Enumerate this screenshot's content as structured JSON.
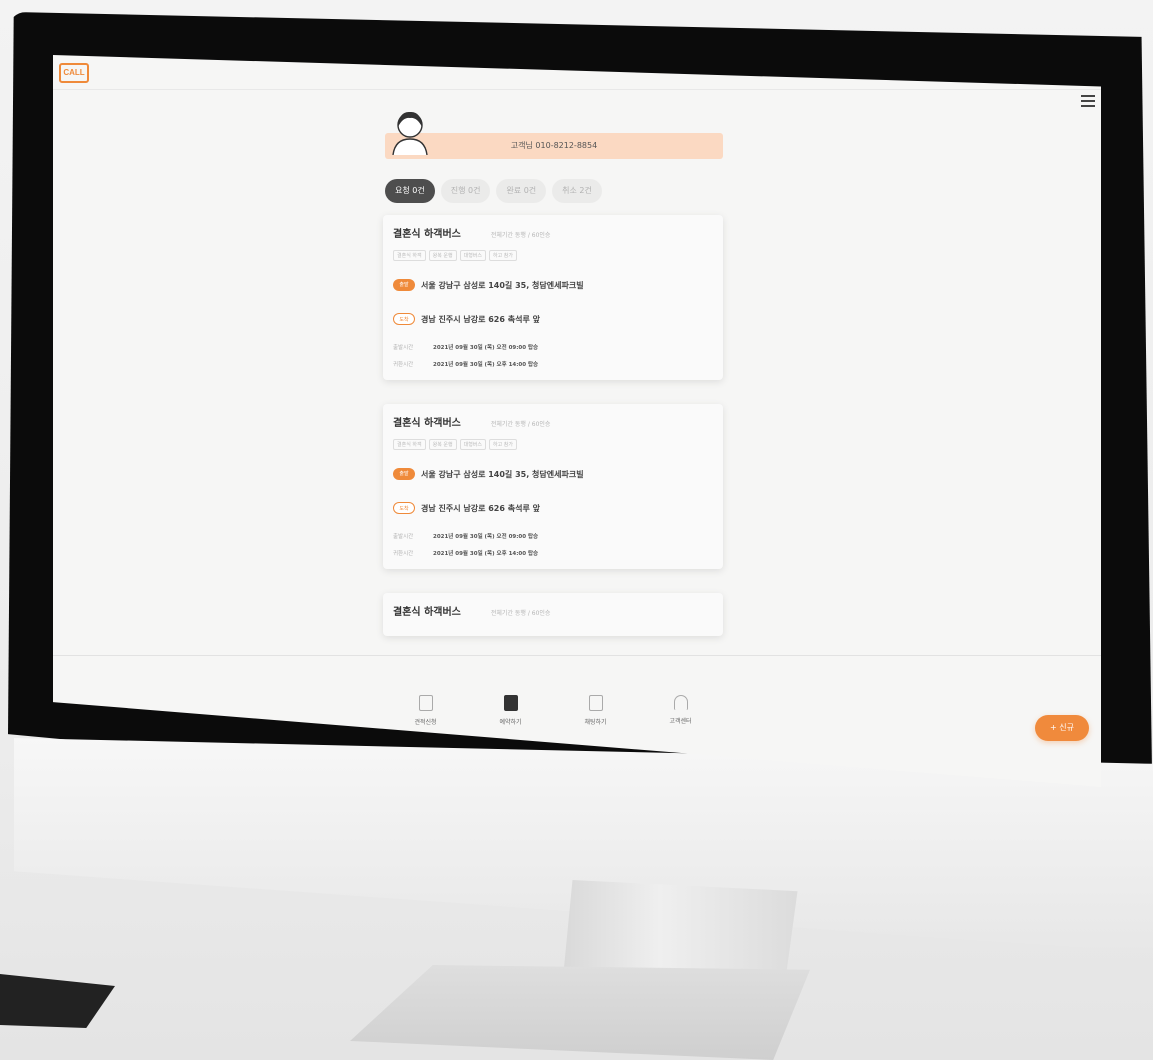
{
  "app": {
    "logo_text": "CALL"
  },
  "profile": {
    "phone_label": "고객님 010-8212-8854"
  },
  "tabs": [
    {
      "label": "요청 0건",
      "active": true
    },
    {
      "label": "진행 0건",
      "active": false
    },
    {
      "label": "완료 0건",
      "active": false
    },
    {
      "label": "취소 2건",
      "active": false
    }
  ],
  "cards": [
    {
      "title": "결혼식 하객버스",
      "subtitle": "전체기간 동행 / 60인승",
      "tags": [
        "결혼식 하객",
        "왕복 운행",
        "대형버스",
        "하고 참가"
      ],
      "depart_badge": "출발",
      "depart": "서울 강남구 삼성로 140길 35, 청담엔세파크빌",
      "arrive_badge": "도착",
      "arrive": "경남 진주시 남강로 626 촉석루 앞",
      "times": [
        {
          "label": "출발시간",
          "value": "2021년 09월 30일 (목) 오전 09:00 탑승"
        },
        {
          "label": "귀환시간",
          "value": "2021년 09월 30일 (목) 오후 14:00 탑승"
        }
      ]
    },
    {
      "title": "결혼식 하객버스",
      "subtitle": "전체기간 동행 / 60인승",
      "tags": [
        "결혼식 하객",
        "왕복 운행",
        "대형버스",
        "하고 참가"
      ],
      "depart_badge": "출발",
      "depart": "서울 강남구 삼성로 140길 35, 청담엔세파크빌",
      "arrive_badge": "도착",
      "arrive": "경남 진주시 남강로 626 촉석루 앞",
      "times": [
        {
          "label": "출발시간",
          "value": "2021년 09월 30일 (목) 오전 09:00 탑승"
        },
        {
          "label": "귀환시간",
          "value": "2021년 09월 30일 (목) 오후 14:00 탑승"
        }
      ]
    },
    {
      "title": "결혼식 하객버스",
      "subtitle": "전체기간 동행 / 60인승"
    }
  ],
  "bottom_nav": [
    {
      "label": "견적신청",
      "icon": "document-icon",
      "active": false
    },
    {
      "label": "예약하기",
      "icon": "book-icon",
      "active": true
    },
    {
      "label": "채팅하기",
      "icon": "chat-icon",
      "active": false
    },
    {
      "label": "고객센터",
      "icon": "headset-icon",
      "active": false
    }
  ],
  "new_button": "+ 신규",
  "colors": {
    "accent": "#ef8a3a",
    "phone_bar": "#fbd9c2"
  }
}
